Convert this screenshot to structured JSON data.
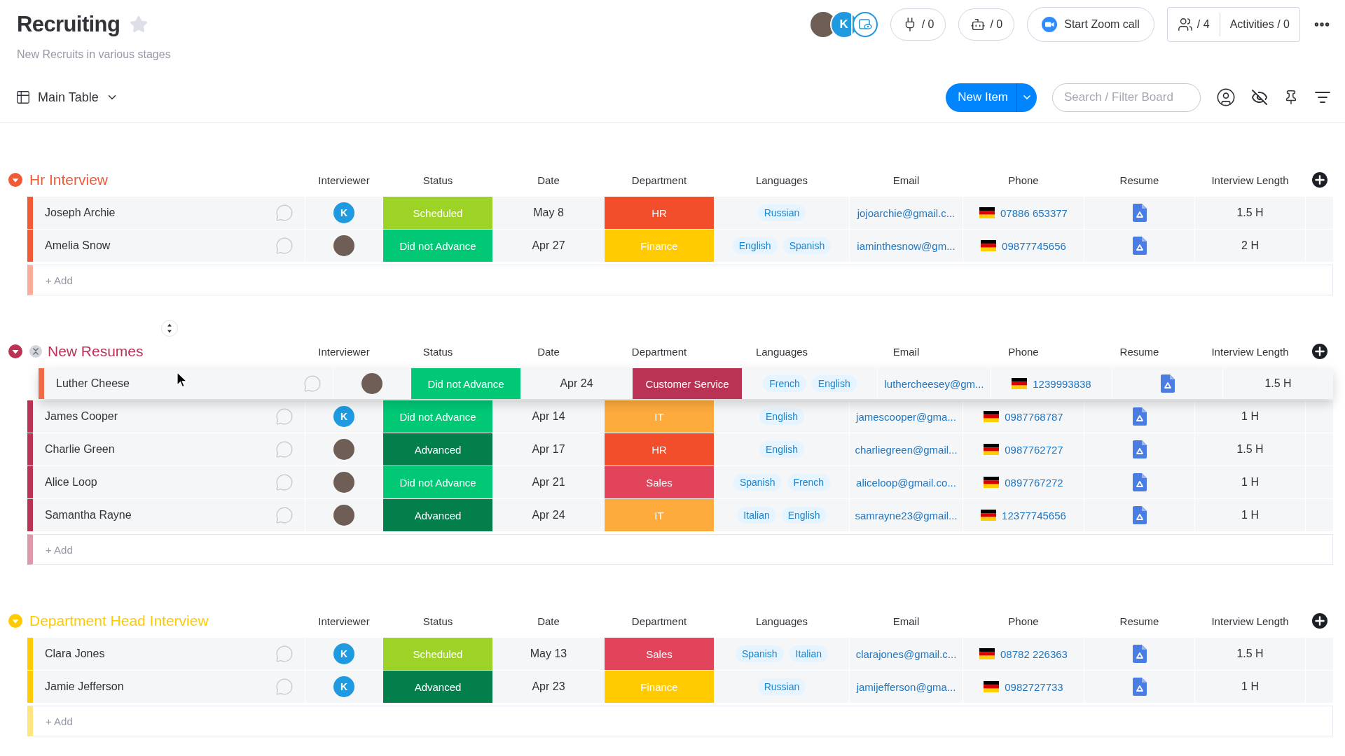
{
  "board": {
    "title": "Recruiting",
    "starred": false,
    "description": "New Recruits in various stages"
  },
  "top_bar": {
    "subscribers": [
      {
        "kind": "photo"
      },
      {
        "kind": "letter",
        "initial": "K"
      }
    ],
    "integrations": "/ 0",
    "automations": "/ 0",
    "zoom_call": "Start Zoom call",
    "members": "/ 4",
    "activities": "Activities / 0"
  },
  "view_bar": {
    "view": "Main Table",
    "new_item": "New Item",
    "search": {
      "placeholder": "Search / Filter Board"
    }
  },
  "groups": [
    {
      "title": "Hr Interview",
      "color": "#f25a36",
      "expanded": true,
      "columns": [
        "Interviewer",
        "Status",
        "Date",
        "Department",
        "Languages",
        "Email",
        "Phone",
        "Resume",
        "Interview Length"
      ],
      "rows": [
        {
          "name": "Joseph Archie",
          "interviewer": {
            "kind": "letter",
            "initial": "K"
          },
          "status": {
            "label": "Scheduled",
            "color": "#9cd326"
          },
          "date": "May 8",
          "department": {
            "label": "HR",
            "color": "#f24e2c"
          },
          "languages": [
            "Russian"
          ],
          "email": "jojoarchie@gmail.c...",
          "phone": "07886 653377",
          "interview_length": "1.5 H"
        },
        {
          "name": "Amelia Snow",
          "interviewer": {
            "kind": "photo"
          },
          "status": {
            "label": "Did not Advance",
            "color": "#00c875"
          },
          "date": "Apr 27",
          "department": {
            "label": "Finance",
            "color": "#ffcb00"
          },
          "languages": [
            "English",
            "Spanish"
          ],
          "email": "iaminthesnow@gm...",
          "phone": "09877745656",
          "interview_length": "2 H"
        }
      ],
      "add_item": {
        "placeholder": "+ Add"
      }
    },
    {
      "title": "New Resumes",
      "color": "#bb3354",
      "expanded": true,
      "columns": [
        "Interviewer",
        "Status",
        "Date",
        "Department",
        "Languages",
        "Email",
        "Phone",
        "Resume",
        "Interview Length"
      ],
      "dragged_row": {
        "name": "Luther Cheese",
        "interviewer": {
          "kind": "photo"
        },
        "status": {
          "label": "Did not Advance",
          "color": "#00c875"
        },
        "date": "Apr 24",
        "department": {
          "label": "Customer Service",
          "color": "#bb3354"
        },
        "languages": [
          "French",
          "English"
        ],
        "email": "luthercheesey@gm...",
        "phone": "1239993838",
        "interview_length": "1.5 H"
      },
      "rows": [
        {
          "name": "James Cooper",
          "interviewer": {
            "kind": "letter",
            "initial": "K"
          },
          "status": {
            "label": "Did not Advance",
            "color": "#00c875"
          },
          "date": "Apr 14",
          "department": {
            "label": "IT",
            "color": "#fdab3d"
          },
          "languages": [
            "English"
          ],
          "email": "jamescooper@gma...",
          "phone": "0987768787",
          "interview_length": "1 H"
        },
        {
          "name": "Charlie Green",
          "interviewer": {
            "kind": "photo"
          },
          "status": {
            "label": "Advanced",
            "color": "#037f4c"
          },
          "date": "Apr 17",
          "department": {
            "label": "HR",
            "color": "#f24e2c"
          },
          "languages": [
            "English"
          ],
          "email": "charliegreen@gmail...",
          "phone": "0987762727",
          "interview_length": "1.5 H"
        },
        {
          "name": "Alice Loop",
          "interviewer": {
            "kind": "photo"
          },
          "status": {
            "label": "Did not Advance",
            "color": "#00c875"
          },
          "date": "Apr 21",
          "department": {
            "label": "Sales",
            "color": "#e2445c"
          },
          "languages": [
            "Spanish",
            "French"
          ],
          "email": "aliceloop@gmail.co...",
          "phone": "0897767272",
          "interview_length": "1 H"
        },
        {
          "name": "Samantha Rayne",
          "interviewer": {
            "kind": "photo"
          },
          "status": {
            "label": "Advanced",
            "color": "#037f4c"
          },
          "date": "Apr 24",
          "department": {
            "label": "IT",
            "color": "#fdab3d"
          },
          "languages": [
            "Italian",
            "English"
          ],
          "email": "samrayne23@gmail...",
          "phone": "12377745656",
          "interview_length": "1 H"
        }
      ],
      "add_item": {
        "placeholder": "+ Add"
      }
    },
    {
      "title": "Department Head Interview",
      "color": "#ffcb00",
      "expanded": true,
      "columns": [
        "Interviewer",
        "Status",
        "Date",
        "Department",
        "Languages",
        "Email",
        "Phone",
        "Resume",
        "Interview Length"
      ],
      "rows": [
        {
          "name": "Clara Jones",
          "interviewer": {
            "kind": "letter",
            "initial": "K"
          },
          "status": {
            "label": "Scheduled",
            "color": "#9cd326"
          },
          "date": "May 13",
          "department": {
            "label": "Sales",
            "color": "#e2445c"
          },
          "languages": [
            "Spanish",
            "Italian"
          ],
          "email": "clarajones@gmail.c...",
          "phone": "08782 226363",
          "interview_length": "1.5 H"
        },
        {
          "name": "Jamie Jefferson",
          "interviewer": {
            "kind": "letter",
            "initial": "K"
          },
          "status": {
            "label": "Advanced",
            "color": "#037f4c"
          },
          "date": "Apr 23",
          "department": {
            "label": "Finance",
            "color": "#ffcb00"
          },
          "languages": [
            "Russian"
          ],
          "email": "jamijefferson@gma...",
          "phone": "0982727733",
          "interview_length": "1 H"
        }
      ],
      "add_item": {
        "placeholder": "+ Add"
      }
    }
  ]
}
